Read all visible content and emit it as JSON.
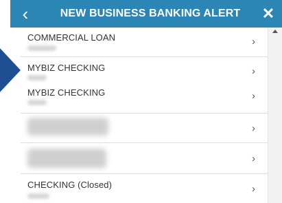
{
  "header": {
    "title": "NEW BUSINESS BANKING ALERT",
    "back_icon": "chevron-left-icon",
    "back_glyph": "‹",
    "close_icon": "close-icon",
    "close_glyph": "✕",
    "bg_color": "#2b86b6"
  },
  "list": {
    "chevron_glyph": "›",
    "items": [
      {
        "label": "COMMERCIAL LOAN"
      },
      {
        "label": "MYBIZ CHECKING"
      },
      {
        "label": "MYBIZ CHECKING"
      },
      {
        "label": ""
      },
      {
        "label": ""
      },
      {
        "label": "CHECKING (Closed)"
      }
    ]
  },
  "annotation": {
    "icon": "pointer-arrow-icon",
    "color": "#1f4f93"
  }
}
